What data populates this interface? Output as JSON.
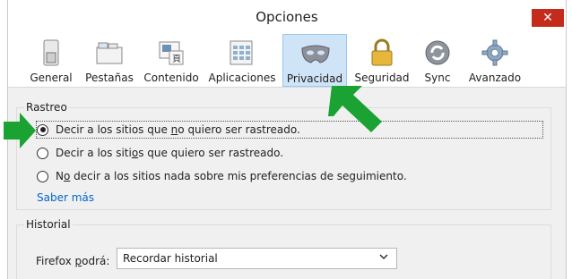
{
  "window": {
    "title": "Opciones",
    "close_symbol": "✕"
  },
  "toolbar": {
    "items": [
      {
        "label": "General",
        "icon": "switch-icon"
      },
      {
        "label": "Pestañas",
        "icon": "tabs-icon"
      },
      {
        "label": "Contenido",
        "icon": "content-icon"
      },
      {
        "label": "Aplicaciones",
        "icon": "applications-icon"
      },
      {
        "label": "Privacidad",
        "icon": "mask-icon",
        "selected": true
      },
      {
        "label": "Seguridad",
        "icon": "padlock-icon"
      },
      {
        "label": "Sync",
        "icon": "sync-icon"
      },
      {
        "label": "Avanzado",
        "icon": "gear-icon"
      }
    ]
  },
  "tracking": {
    "title": "Rastreo",
    "options": [
      {
        "pre": "Decir a los sitios que ",
        "accel": "n",
        "post": "o quiero ser rastreado.",
        "checked": true
      },
      {
        "pre": "Decir a los siti",
        "accel": "o",
        "post": "s que quiero ser rastreado.",
        "checked": false
      },
      {
        "pre": "N",
        "accel": "o",
        "post": " decir a los sitios nada sobre mis preferencias de seguimiento.",
        "checked": false
      }
    ],
    "link": "Saber más"
  },
  "history": {
    "title": "Historial",
    "label_pre": "Firefox ",
    "label_accel": "p",
    "label_post": "odrá:",
    "select_value": "Recordar historial"
  },
  "colors": {
    "accent_green": "#1aa233",
    "selected_tab": "#cfe4f7",
    "link": "#0066cc"
  }
}
